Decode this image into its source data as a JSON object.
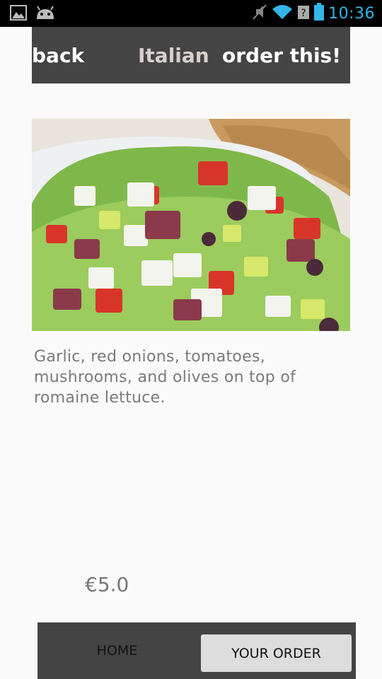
{
  "status_bar": {
    "time": "10:36",
    "icons": [
      "gallery-icon",
      "android-icon",
      "mute-icon",
      "wifi-icon",
      "no-signal-icon",
      "battery-icon"
    ],
    "accent_color": "#33b5e5"
  },
  "action_bar": {
    "back_label": "back",
    "title": "Italian",
    "order_label": "order this!"
  },
  "dish": {
    "image_icon": "salad-photo",
    "description": "Garlic, red onions, tomatoes, mushrooms, and olives on top of romaine lettuce.",
    "price": "€5.0"
  },
  "bottom_nav": {
    "home_label": "HOME",
    "order_label": "YOUR ORDER"
  }
}
